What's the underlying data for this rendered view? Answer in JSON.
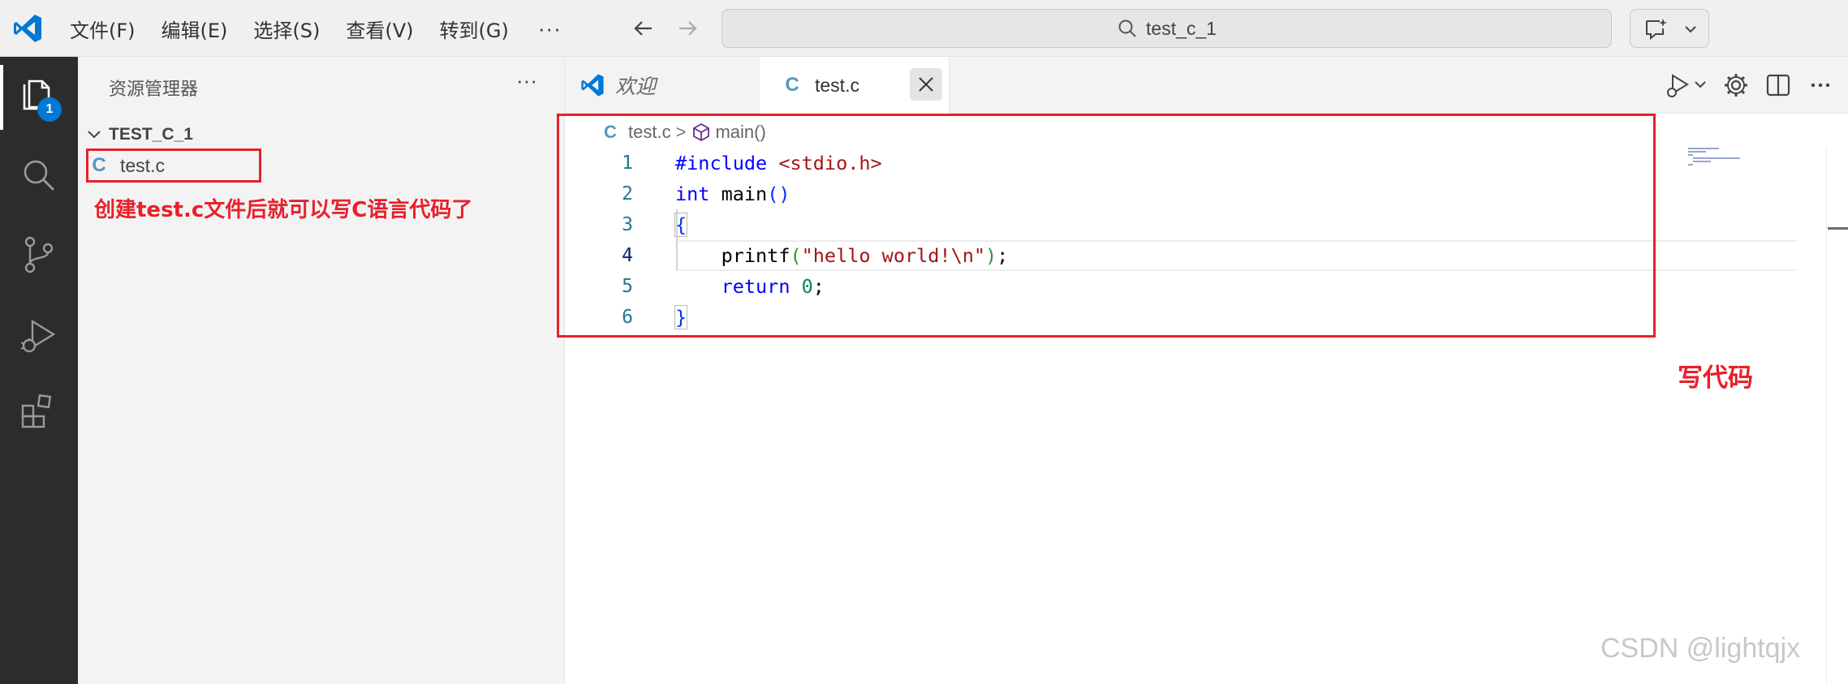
{
  "menu": {
    "file": "文件(F)",
    "edit": "编辑(E)",
    "selection": "选择(S)",
    "view": "查看(V)",
    "goto": "转到(G)",
    "more": "···"
  },
  "command_center": {
    "text": "test_c_1"
  },
  "activity_bar": {
    "explorer_badge": "1"
  },
  "sidebar": {
    "title": "资源管理器",
    "more": "···",
    "folder": "TEST_C_1",
    "file_icon": "C",
    "file": "test.c"
  },
  "annotations": {
    "left": "创建test.c文件后就可以写C语言代码了",
    "right": "写代码",
    "highlight_color": "#e8202a"
  },
  "tabs": {
    "welcome": "欢迎",
    "active_icon": "C",
    "active": "test.c"
  },
  "breadcrumb": {
    "icon": "C",
    "file": "test.c",
    "sep": ">",
    "symbol": "main()"
  },
  "editor": {
    "line_numbers": [
      "1",
      "2",
      "3",
      "4",
      "5",
      "6"
    ],
    "current_line": 4,
    "lines": {
      "l1_directive": "#include",
      "l1_header": "<stdio.h>",
      "l2_type": "int",
      "l2_name": " main",
      "l2_parens": "()",
      "l3_brace": "{",
      "l4_indent": "    ",
      "l4_func": "printf",
      "l4_open": "(",
      "l4_string": "\"hello world!\\n\"",
      "l4_close": ")",
      "l4_semi": ";",
      "l5_indent": "    ",
      "l5_kw": "return",
      "l5_space": " ",
      "l5_num": "0",
      "l5_semi": ";",
      "l6_brace": "}"
    }
  },
  "colors": {
    "keyword": "#0000ff",
    "string": "#a31515",
    "number": "#098658",
    "line_number": "#237893",
    "c_icon": "#519aba",
    "badge": "#0078d4"
  },
  "watermark": "CSDN @lightqjx"
}
